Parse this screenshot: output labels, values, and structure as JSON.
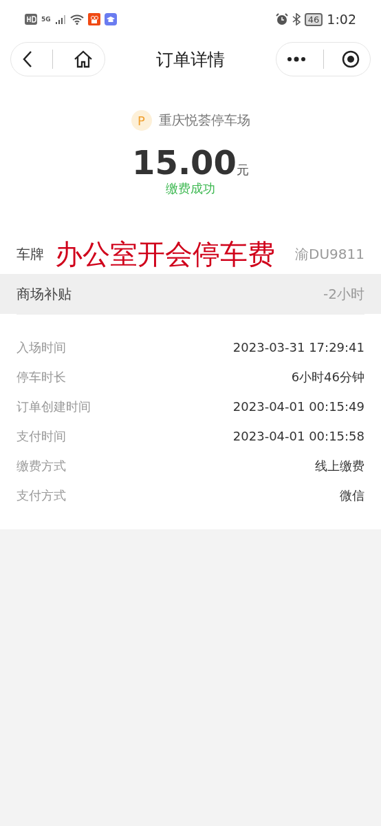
{
  "status_bar": {
    "network": "5G",
    "battery": "46",
    "time": "1:02"
  },
  "header": {
    "title": "订单详情"
  },
  "parking_lot": {
    "badge": "P",
    "name": "重庆悦荟停车场"
  },
  "amount": {
    "value": "15.00",
    "unit": "元",
    "status": "缴费成功"
  },
  "annotation": "办公室开会停车费",
  "summary_rows": [
    {
      "label": "车牌",
      "value": "渝DU9811",
      "shaded": false
    },
    {
      "label": "商场补贴",
      "value": "-2小时",
      "shaded": true
    }
  ],
  "details": [
    {
      "label": "入场时间",
      "value": "2023-03-31 17:29:41"
    },
    {
      "label": "停车时长",
      "value": "6小时46分钟"
    },
    {
      "label": "订单创建时间",
      "value": "2023-04-01 00:15:49"
    },
    {
      "label": "支付时间",
      "value": "2023-04-01 00:15:58"
    },
    {
      "label": "缴费方式",
      "value": "线上缴费"
    },
    {
      "label": "支付方式",
      "value": "微信"
    }
  ]
}
